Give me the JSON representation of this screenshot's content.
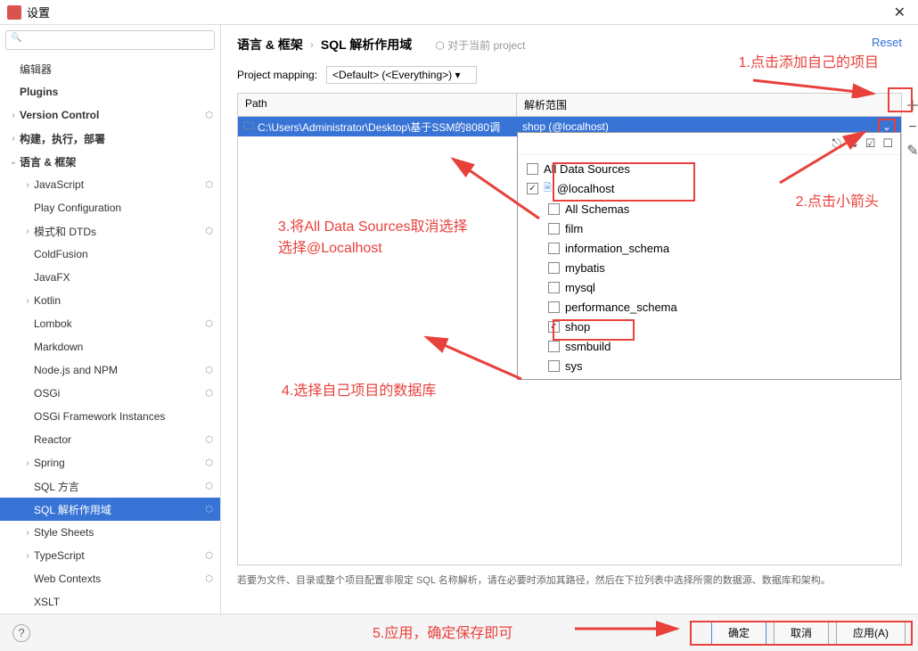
{
  "window": {
    "title": "设置"
  },
  "search": {
    "placeholder": ""
  },
  "sidebar": {
    "items": [
      {
        "label": "编辑器",
        "depth": 0,
        "chev": "",
        "bold": false,
        "badge": ""
      },
      {
        "label": "Plugins",
        "depth": 0,
        "chev": "",
        "bold": true,
        "badge": ""
      },
      {
        "label": "Version Control",
        "depth": 0,
        "chev": "›",
        "bold": true,
        "badge": "⬡"
      },
      {
        "label": "构建，执行，部署",
        "depth": 0,
        "chev": "›",
        "bold": true,
        "badge": ""
      },
      {
        "label": "语言 & 框架",
        "depth": 0,
        "chev": "⌄",
        "bold": true,
        "badge": ""
      },
      {
        "label": "JavaScript",
        "depth": 1,
        "chev": "›",
        "bold": false,
        "badge": "⬡"
      },
      {
        "label": "Play Configuration",
        "depth": 1,
        "chev": "",
        "bold": false,
        "badge": ""
      },
      {
        "label": "模式和 DTDs",
        "depth": 1,
        "chev": "›",
        "bold": false,
        "badge": "⬡"
      },
      {
        "label": "ColdFusion",
        "depth": 1,
        "chev": "",
        "bold": false,
        "badge": ""
      },
      {
        "label": "JavaFX",
        "depth": 1,
        "chev": "",
        "bold": false,
        "badge": ""
      },
      {
        "label": "Kotlin",
        "depth": 1,
        "chev": "›",
        "bold": false,
        "badge": ""
      },
      {
        "label": "Lombok",
        "depth": 1,
        "chev": "",
        "bold": false,
        "badge": "⬡"
      },
      {
        "label": "Markdown",
        "depth": 1,
        "chev": "",
        "bold": false,
        "badge": ""
      },
      {
        "label": "Node.js and NPM",
        "depth": 1,
        "chev": "",
        "bold": false,
        "badge": "⬡"
      },
      {
        "label": "OSGi",
        "depth": 1,
        "chev": "",
        "bold": false,
        "badge": "⬡"
      },
      {
        "label": "OSGi Framework Instances",
        "depth": 1,
        "chev": "",
        "bold": false,
        "badge": ""
      },
      {
        "label": "Reactor",
        "depth": 1,
        "chev": "",
        "bold": false,
        "badge": "⬡"
      },
      {
        "label": "Spring",
        "depth": 1,
        "chev": "›",
        "bold": false,
        "badge": "⬡"
      },
      {
        "label": "SQL 方言",
        "depth": 1,
        "chev": "",
        "bold": false,
        "badge": "⬡"
      },
      {
        "label": "SQL 解析作用域",
        "depth": 1,
        "chev": "",
        "bold": false,
        "badge": "⬡",
        "selected": true
      },
      {
        "label": "Style Sheets",
        "depth": 1,
        "chev": "›",
        "bold": false,
        "badge": ""
      },
      {
        "label": "TypeScript",
        "depth": 1,
        "chev": "›",
        "bold": false,
        "badge": "⬡"
      },
      {
        "label": "Web Contexts",
        "depth": 1,
        "chev": "",
        "bold": false,
        "badge": "⬡"
      },
      {
        "label": "XSLT",
        "depth": 1,
        "chev": "",
        "bold": false,
        "badge": ""
      }
    ]
  },
  "main": {
    "breadcrumb": {
      "a": "语言 & 框架",
      "b": "SQL 解析作用域"
    },
    "hint": "对于当前 project",
    "reset": "Reset",
    "mapping_label": "Project mapping:",
    "mapping_value": "<Default> (<Everything>)",
    "table": {
      "th_path": "Path",
      "th_scope": "解析范围",
      "row_path": "C:\\Users\\Administrator\\Desktop\\基于SSM的8080调",
      "row_scope": "shop (@localhost)"
    },
    "dropdown": {
      "items": [
        {
          "label": "All Data Sources",
          "checked": false,
          "indent": false,
          "icon": ""
        },
        {
          "label": "@localhost",
          "checked": true,
          "indent": false,
          "icon": "db"
        },
        {
          "label": "All Schemas",
          "checked": false,
          "indent": true,
          "icon": ""
        },
        {
          "label": "film",
          "checked": false,
          "indent": true,
          "icon": ""
        },
        {
          "label": "information_schema",
          "checked": false,
          "indent": true,
          "icon": ""
        },
        {
          "label": "mybatis",
          "checked": false,
          "indent": true,
          "icon": ""
        },
        {
          "label": "mysql",
          "checked": false,
          "indent": true,
          "icon": ""
        },
        {
          "label": "performance_schema",
          "checked": false,
          "indent": true,
          "icon": ""
        },
        {
          "label": "shop",
          "checked": true,
          "indent": true,
          "icon": ""
        },
        {
          "label": "ssmbuild",
          "checked": false,
          "indent": true,
          "icon": ""
        },
        {
          "label": "sys",
          "checked": false,
          "indent": true,
          "icon": ""
        }
      ]
    },
    "footer_note": "若要为文件、目录或整个项目配置非限定 SQL 名称解析，请在必要时添加其路径，然后在下拉列表中选择所需的数据源、数据库和架构。"
  },
  "buttons": {
    "ok": "确定",
    "cancel": "取消",
    "apply": "应用(A)"
  },
  "annotations": {
    "a1": "1.点击添加自己的项目",
    "a2": "2.点击小箭头",
    "a3a": "3.将All Data Sources取消选择",
    "a3b": "选择@Localhost",
    "a4": "4.选择自己项目的数据库",
    "a5": "5.应用，确定保存即可"
  }
}
